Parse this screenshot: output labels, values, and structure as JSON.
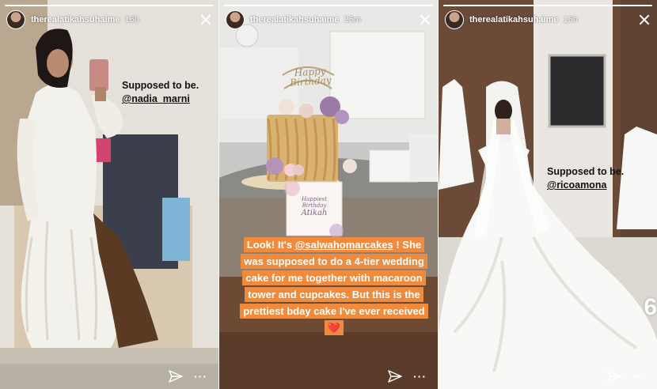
{
  "stories": [
    {
      "username": "therealatikahsuhaime",
      "time": "16h",
      "caption_line1": "Supposed to be.",
      "caption_mention": "@nadia_marni",
      "progress_segments": 3,
      "active_segment": 1
    },
    {
      "username": "therealatikahsuhaime",
      "time": "25m",
      "caption_mention": "@salwahomarcakes",
      "caption_text": "Look! It's @salwahomarcakes ! She was supposed to do a 4-tier wedding cake for me together with macaroon tower and cupcakes. But this is the prettiest bday cake I've ever received",
      "caption_prefix": "Look! It's ",
      "caption_suffix": " ! She was supposed to do a 4-tier wedding cake for me together with macaroon tower and cupcakes. But this is the prettiest bday cake I've ever received ",
      "heart": "❤️",
      "cake_topper": "Happy Birthday",
      "card_text_1": "Happiest",
      "card_text_2": "Birthday",
      "card_text_3": "Atikah",
      "progress_segments": 3,
      "active_segment": 2
    },
    {
      "username": "therealatikahsuhaime",
      "time": "16h",
      "caption_line1": "Supposed to be.",
      "caption_mention": "@ricoamona",
      "progress_segments": 3,
      "active_segment": 3,
      "edge_number": "6"
    }
  ],
  "icons": {
    "send": "paper-plane-icon",
    "more": "more-dots-icon",
    "close": "close-icon"
  },
  "more_glyph": "···",
  "colors": {
    "caption_bg": "#f08a3c",
    "caption_text": "#ffffff",
    "panel_divider": "#ffffff"
  }
}
